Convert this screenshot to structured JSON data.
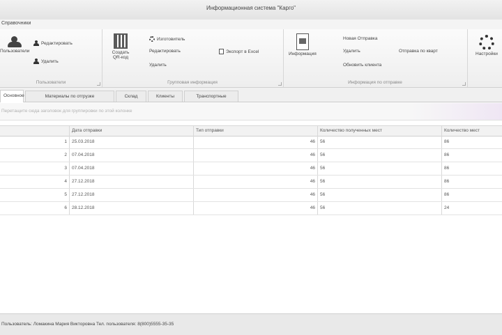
{
  "window": {
    "title": "Информационная система \"Карго\""
  },
  "menu": {
    "file_label": "Справочники"
  },
  "ribbon": {
    "groups": [
      {
        "label": "Пользователи",
        "buttons": [
          "Пользователи",
          "Редактировать",
          "Удалить"
        ]
      },
      {
        "label": "Групповая информация",
        "buttons": [
          "Создать QR-код",
          "Изготовитель",
          "Редактировать",
          "Удалить",
          "Экспорт в Excel"
        ]
      },
      {
        "label": "Информация по отправке",
        "buttons": [
          "Информация",
          "Новая Отправка",
          "Удалить",
          "Обновить клиента",
          "Отправка по кварт"
        ]
      },
      {
        "label": "",
        "buttons": [
          "Настройки"
        ]
      }
    ]
  },
  "tabs": [
    "Основное",
    "Материалы по отгрузке",
    "Склад",
    "Клиенты",
    "Транспортные"
  ],
  "hint_text": "Перетащите сюда заголовок для группировки по этой колонке",
  "grid": {
    "columns": [
      "",
      "Дата отправки",
      "Тип отправки",
      "Количество полученных мест",
      "Количество мест"
    ],
    "rows": [
      [
        "1",
        "25.03.2018",
        "46",
        "56",
        "86"
      ],
      [
        "2",
        "07.04.2018",
        "46",
        "56",
        "86"
      ],
      [
        "3",
        "07.04.2018",
        "46",
        "56",
        "86"
      ],
      [
        "4",
        "27.12.2018",
        "46",
        "56",
        "86"
      ],
      [
        "5",
        "27.12.2018",
        "46",
        "56",
        "86"
      ],
      [
        "6",
        "28.12.2018",
        "46",
        "56",
        "24"
      ]
    ]
  },
  "status": {
    "text": "Пользователь: Ломакина Мария Викторовна     Тел. пользователя: 8(800)5555-35-35"
  }
}
